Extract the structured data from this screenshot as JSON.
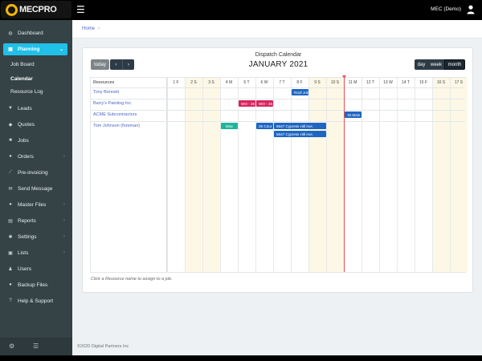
{
  "app": {
    "brand": "MECPRO",
    "user": "MEC (Demo)"
  },
  "sidebar": {
    "items": [
      {
        "label": "Dashboard",
        "icon": "palette-icon"
      },
      {
        "label": "Planning",
        "icon": "calendar-icon",
        "active": true
      },
      {
        "label": "Leads",
        "icon": "filter-icon"
      },
      {
        "label": "Quotes",
        "icon": "comments-icon"
      },
      {
        "label": "Jobs",
        "icon": "truck-icon"
      },
      {
        "label": "Orders",
        "icon": "cart-icon"
      },
      {
        "label": "Pre-invoicing",
        "icon": "chart-icon"
      },
      {
        "label": "Send Message",
        "icon": "envelope-icon"
      },
      {
        "label": "Master Files",
        "icon": "database-icon"
      },
      {
        "label": "Reports",
        "icon": "report-icon"
      },
      {
        "label": "Settings",
        "icon": "gear-icon"
      },
      {
        "label": "Lists",
        "icon": "list-icon"
      },
      {
        "label": "Users",
        "icon": "users-icon"
      },
      {
        "label": "Backup Files",
        "icon": "backup-icon"
      },
      {
        "label": "Help & Support",
        "icon": "question-icon"
      }
    ],
    "sub_items": [
      "Job Board",
      "Calendar",
      "Resource Log"
    ]
  },
  "breadcrumb": {
    "home": "Home",
    "sep": "›"
  },
  "calendar": {
    "title": "Dispatch Calendar",
    "month": "JANUARY 2021",
    "today_label": "today",
    "prev": "‹",
    "next": "›",
    "views": {
      "day": "day",
      "week": "week",
      "month": "month"
    },
    "selected_view": "month",
    "resources_header": "Resources",
    "days": [
      "1 F",
      "2 S",
      "3 S",
      "4 M",
      "5 T",
      "6 W",
      "7 T",
      "8 F",
      "9 S",
      "10 S",
      "11 M",
      "12 T",
      "13 W",
      "14 T",
      "15 F",
      "16 S",
      "17 S"
    ],
    "weekend_indexes": [
      1,
      2,
      8,
      9,
      15,
      16
    ],
    "today_index": 10,
    "resources": [
      "Tony Bennett",
      "Barry's Painting Inc",
      "ACME Subcontractors",
      "Tom Johnson (foreman)"
    ],
    "events": [
      {
        "label": "Roof Job",
        "color": "blue"
      },
      {
        "label": "WO - 25",
        "color": "red"
      },
      {
        "label": "WO - 25",
        "color": "red"
      },
      {
        "label": "19 Main",
        "color": "blue"
      },
      {
        "label": "Misc",
        "color": "green"
      },
      {
        "label": "25 Cour",
        "color": "blue"
      },
      {
        "label": "5647 Cypress Hill Ave.",
        "color": "blue"
      },
      {
        "label": "5647 Cypress Hill Ave.",
        "color": "blue"
      }
    ],
    "hint": "Click a Resource name to assign to a job."
  },
  "footer": {
    "copyright": "©2020 Digital Partners Inc"
  },
  "colors": {
    "accent": "#20c0e8",
    "sidebar": "#354347",
    "event_blue": "#1f66c2",
    "event_red": "#d6265e",
    "event_green": "#1fb59b",
    "today": "#e74c5a"
  }
}
